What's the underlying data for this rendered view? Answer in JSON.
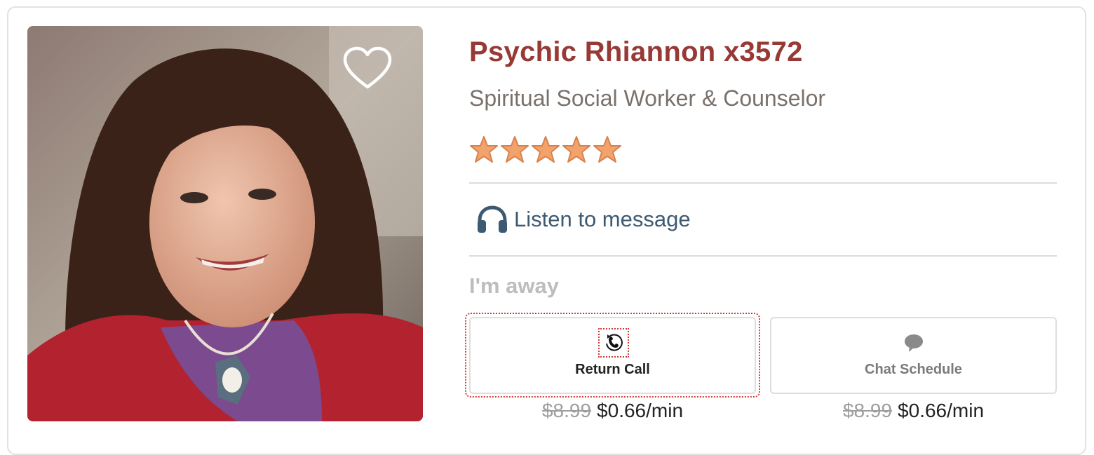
{
  "advisor": {
    "name": "Psychic Rhiannon x3572",
    "title": "Spiritual Social Worker & Counselor",
    "rating": 5,
    "rating_max": 5
  },
  "listen": {
    "label": "Listen to message",
    "icon": "headphones-icon"
  },
  "status": {
    "text": "I'm away"
  },
  "actions": [
    {
      "label": "Return Call",
      "icon": "return-call-icon",
      "old_price": "$8.99",
      "price": "$0.66/min",
      "focused": true
    },
    {
      "label": "Chat Schedule",
      "icon": "chat-bubble-icon",
      "old_price": "$8.99",
      "price": "$0.66/min",
      "focused": false
    }
  ],
  "colors": {
    "name": "#973a36",
    "subtitle": "#7a716b",
    "listen": "#3d5a73",
    "status": "#bdbdbd",
    "star": "#f2a36b",
    "focus_ring": "#d23a3a"
  }
}
